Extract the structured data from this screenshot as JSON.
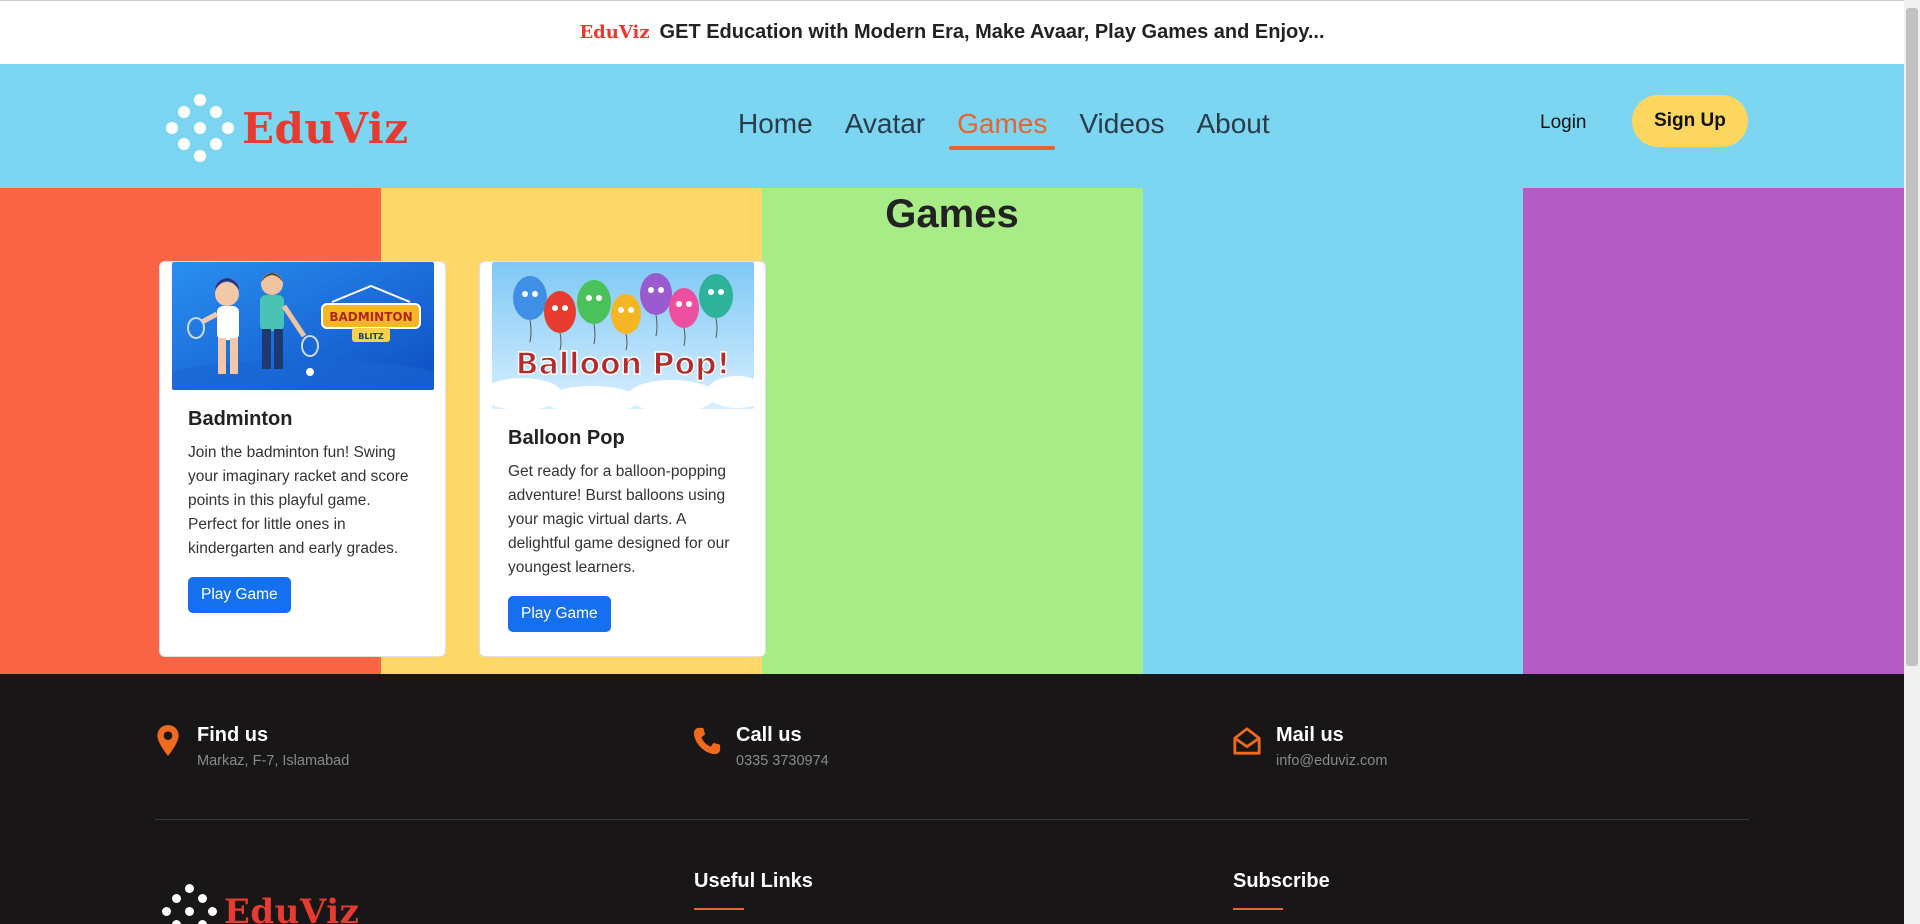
{
  "top_bar": {
    "brand": "EduViz",
    "tagline": "GET Education with Modern Era, Make Avaar, Play Games and Enjoy..."
  },
  "header": {
    "logo_text": "EduViz",
    "nav": [
      {
        "label": "Home",
        "active": false
      },
      {
        "label": "Avatar",
        "active": false
      },
      {
        "label": "Games",
        "active": true
      },
      {
        "label": "Videos",
        "active": false
      },
      {
        "label": "About",
        "active": false
      }
    ],
    "login_label": "Login",
    "signup_label": "Sign Up"
  },
  "colors": {
    "stripe_red": "#fc6446",
    "stripe_yellow": "#fdd767",
    "stripe_green": "#a7ec87",
    "stripe_blue": "#7dd6f1",
    "stripe_purple": "#b45bc6",
    "accent": "#e8632e",
    "button_blue": "#1570ef"
  },
  "main": {
    "title": "Games",
    "cards": [
      {
        "title": "Badminton",
        "description": "Join the badminton fun! Swing your imaginary racket and score points in this playful game. Perfect for little ones in kindergarten and early grades.",
        "button": "Play Game",
        "image_logo_line1": "BADMINTON",
        "image_logo_line2": "BLITZ"
      },
      {
        "title": "Balloon Pop",
        "description": "Get ready for a balloon-popping adventure! Burst balloons using your magic virtual darts. A delightful game designed for our youngest learners.",
        "button": "Play Game",
        "image_text": "Balloon Pop!"
      }
    ]
  },
  "footer": {
    "find_us": {
      "title": "Find us",
      "value": "Markaz, F-7, Islamabad"
    },
    "call_us": {
      "title": "Call us",
      "value": "0335 3730974"
    },
    "mail_us": {
      "title": "Mail us",
      "value": "info@eduviz.com"
    },
    "useful_links": "Useful Links",
    "subscribe": "Subscribe",
    "logo_text": "EduViz"
  }
}
